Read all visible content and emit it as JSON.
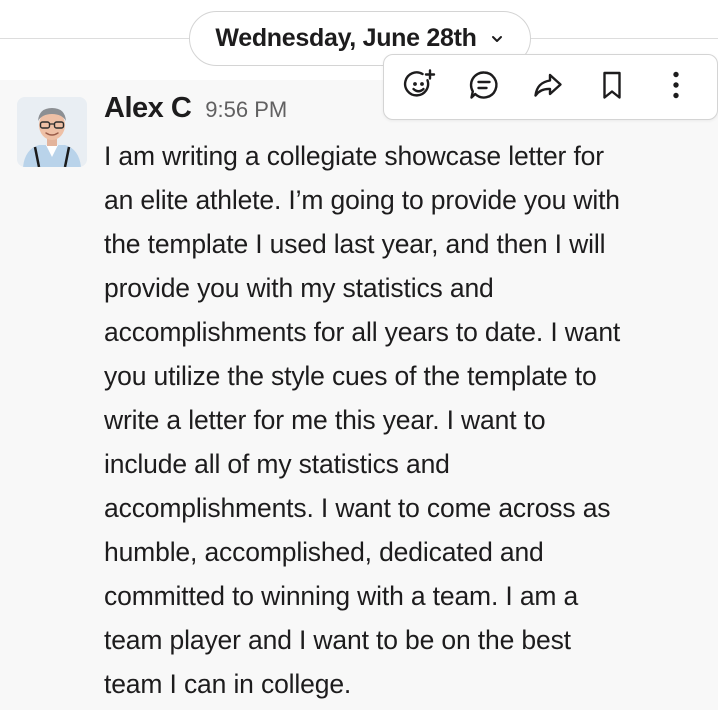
{
  "date_divider": {
    "label": "Wednesday, June 28th",
    "chevron_icon": "chevron-down-icon"
  },
  "message": {
    "sender": "Alex C",
    "time": "9:56 PM",
    "avatar_icon": "user-photo-avatar",
    "text": "I am writing a collegiate showcase letter for\nan elite athlete.  I’m going to provide you with\nthe template I used last year, and then I will\nprovide you with my statistics and\naccomplishments for all years to date.  I want\nyou utilize the style cues of the template to\nwrite a letter for me this year.  I want to\ninclude all of my statistics and\naccomplishments.  I want to come across as\nhumble, accomplished, dedicated and\ncommitted to winning with a team.  I am a\nteam player and I want to be on the best\nteam I can in college."
  },
  "toolbar": {
    "icons": [
      "add-reaction-icon",
      "reply-in-thread-icon",
      "forward-icon",
      "bookmark-icon",
      "more-actions-icon"
    ]
  },
  "colors": {
    "text_primary": "#1d1c1d",
    "text_secondary": "#616061",
    "message_background": "#f8f8f8",
    "border": "#d4d4d4",
    "icon": "#1d1c1d"
  }
}
